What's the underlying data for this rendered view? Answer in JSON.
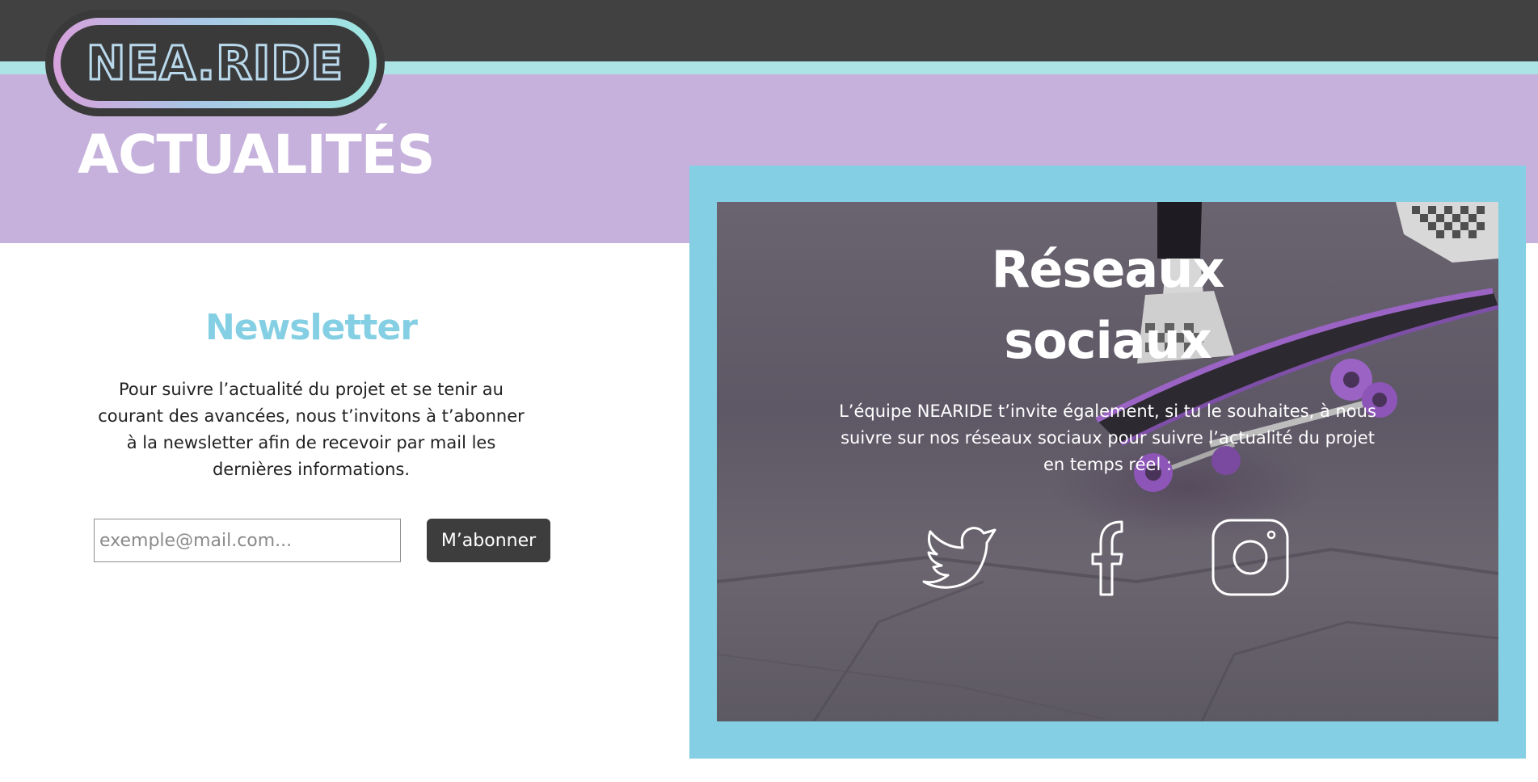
{
  "header": {
    "logo_text": "NEA.RIDE",
    "page_title": "ACTUALITÉS"
  },
  "newsletter": {
    "title": "Newsletter",
    "description": "Pour suivre l’actualité du projet et se tenir au courant des avancées, nous t’invitons à t’abonner à la newsletter afin de recevoir par mail les dernières informations.",
    "email_placeholder": "exemple@mail.com...",
    "subscribe_label": "M’abonner"
  },
  "social": {
    "title": "Réseaux sociaux",
    "description": "L’équipe NEARIDE t’invite également, si tu le souhaites, à nous suivre sur nos réseaux sociaux pour suivre l’actualité du projet en temps réel :",
    "icons": [
      "twitter-icon",
      "facebook-icon",
      "instagram-icon"
    ]
  },
  "colors": {
    "topbar": "#414141",
    "stripe": "#ace4e6",
    "hero_band": "#c6b1dc",
    "accent_blue": "#84cfe3",
    "button_dark": "#3d3d3d",
    "skateboard_purple": "#9a63c4"
  }
}
